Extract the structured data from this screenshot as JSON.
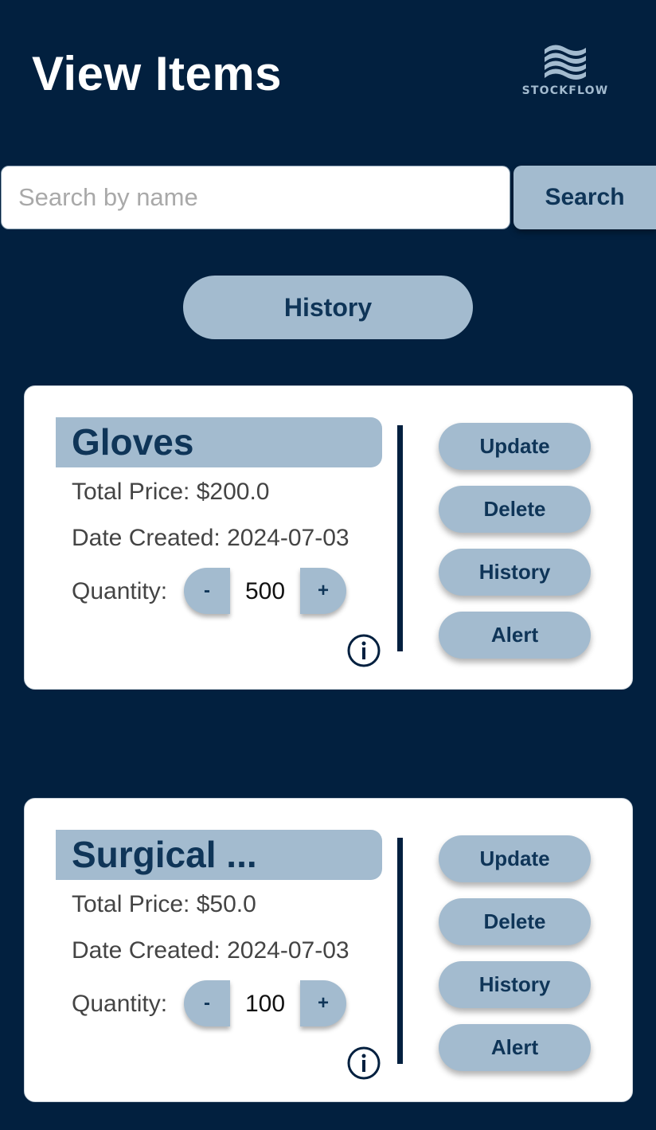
{
  "header": {
    "title": "View Items",
    "logo_text": "STOCKFLOW"
  },
  "search": {
    "placeholder": "Search by name",
    "value": "",
    "button_label": "Search"
  },
  "history_button_label": "History",
  "items": [
    {
      "name": "Gloves",
      "total_price_label": "Total Price:",
      "total_price": "$200.0",
      "date_created_label": "Date Created:",
      "date_created": "2024-07-03",
      "quantity_label": "Quantity:",
      "quantity": "500",
      "minus_label": "-",
      "plus_label": "+",
      "actions": {
        "update": "Update",
        "delete": "Delete",
        "history": "History",
        "alert": "Alert"
      }
    },
    {
      "name": "Surgical ...",
      "total_price_label": "Total Price:",
      "total_price": "$50.0",
      "date_created_label": "Date Created:",
      "date_created": "2024-07-03",
      "quantity_label": "Quantity:",
      "quantity": "100",
      "minus_label": "-",
      "plus_label": "+",
      "actions": {
        "update": "Update",
        "delete": "Delete",
        "history": "History",
        "alert": "Alert"
      }
    }
  ],
  "colors": {
    "background": "#02203f",
    "accent": "#a3bbcf",
    "accent_text": "#0f3558",
    "card": "#ffffff"
  }
}
